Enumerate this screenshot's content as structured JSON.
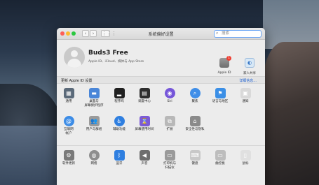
{
  "window": {
    "title": "系统偏好设置",
    "search_placeholder": "搜索",
    "nav": {
      "back": "‹",
      "forward": "›",
      "grid": "⋮⋮⋮"
    }
  },
  "user": {
    "name": "Buds3 Free",
    "subtitle": "Apple ID、iCloud、媒体与 App Store"
  },
  "top_items": {
    "apple_id": {
      "label": "Apple ID",
      "badge": "1",
      "glyph": ""
    },
    "family": {
      "label": "家人共享",
      "glyph": "◐"
    }
  },
  "banner": {
    "left": "更新 Apple ID 设置",
    "right": "详细信息..."
  },
  "rows": [
    [
      {
        "label": "通用",
        "icon": "general-icon",
        "glyph": "▦",
        "color": "#5b6a7a"
      },
      {
        "label": "桌面与\n屏幕保护程序",
        "icon": "desktop-icon",
        "glyph": "▬",
        "color": "#4a86d8"
      },
      {
        "label": "程序坞",
        "icon": "dock-icon",
        "glyph": "▂",
        "color": "#202020"
      },
      {
        "label": "调度中心",
        "icon": "mission-control-icon",
        "glyph": "▤",
        "color": "#2d2d2d"
      },
      {
        "label": "Siri",
        "icon": "siri-icon",
        "glyph": "◉",
        "color": "#7656d9"
      },
      {
        "label": "聚焦",
        "icon": "spotlight-icon",
        "glyph": "⌕",
        "color": "#3f8ee8"
      },
      {
        "label": "语言与地区",
        "icon": "language-icon",
        "glyph": "⚑",
        "color": "#3b8fe6"
      },
      {
        "label": "通知",
        "icon": "notifications-icon",
        "glyph": "▣",
        "color": "#d9d9d9"
      }
    ],
    [
      {
        "label": "互联网\n帐户",
        "icon": "internet-accounts-icon",
        "glyph": "@",
        "color": "#3c8ce6"
      },
      {
        "label": "用户与群组",
        "icon": "users-icon",
        "glyph": "👥",
        "color": "#9a9a9a"
      },
      {
        "label": "辅助功能",
        "icon": "accessibility-icon",
        "glyph": "♿",
        "color": "#2f7fe0"
      },
      {
        "label": "屏幕使用时间",
        "icon": "screen-time-icon",
        "glyph": "⌛",
        "color": "#7b5bd6"
      },
      {
        "label": "扩展",
        "icon": "extensions-icon",
        "glyph": "⧉",
        "color": "#b8b8b8"
      },
      {
        "label": "安全性与隐私",
        "icon": "security-icon",
        "glyph": "⌂",
        "color": "#8a8a8a"
      }
    ],
    [
      {
        "label": "软件更新",
        "icon": "software-update-icon",
        "glyph": "⚙",
        "color": "#7a7a7a"
      },
      {
        "label": "网络",
        "icon": "network-icon",
        "glyph": "◍",
        "color": "#8e8e8e"
      },
      {
        "label": "蓝牙",
        "icon": "bluetooth-icon",
        "glyph": "ᛒ",
        "color": "#2f7fe0"
      },
      {
        "label": "声音",
        "icon": "sound-icon",
        "glyph": "◀",
        "color": "#6e6e6e"
      },
      {
        "label": "打印机与\n扫描仪",
        "icon": "printers-icon",
        "glyph": "▭",
        "color": "#9a9a9a"
      },
      {
        "label": "键盘",
        "icon": "keyboard-icon",
        "glyph": "⌨",
        "color": "#c8c8c8"
      },
      {
        "label": "触控板",
        "icon": "trackpad-icon",
        "glyph": "▭",
        "color": "#bdbdbd"
      },
      {
        "label": "鼠标",
        "icon": "mouse-icon",
        "glyph": "▯",
        "color": "#e0e0e0"
      }
    ]
  ]
}
